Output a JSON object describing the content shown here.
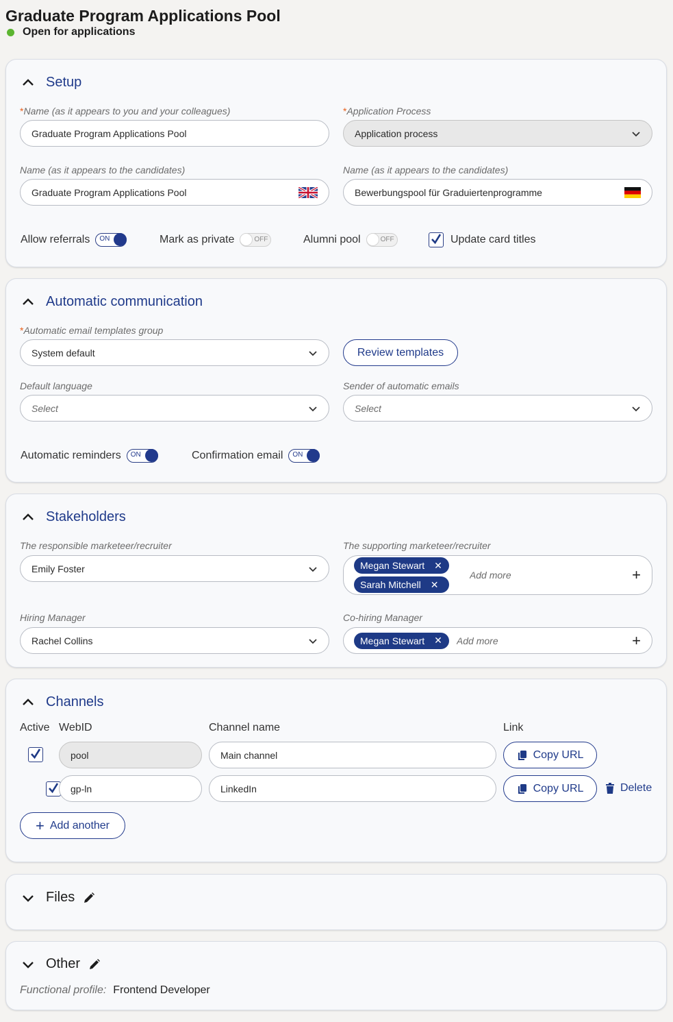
{
  "page": {
    "title": "Graduate Program Applications Pool",
    "status": "Open for applications"
  },
  "setup": {
    "title": "Setup",
    "name_internal_label": "Name (as it appears to you and your colleagues)",
    "name_internal_value": "Graduate Program Applications Pool",
    "process_label": "Application Process",
    "process_value": "Application process",
    "name_candidates_en_label": "Name (as it appears to the candidates)",
    "name_candidates_en_value": "Graduate Program Applications Pool",
    "name_candidates_de_label": "Name (as it appears to the candidates)",
    "name_candidates_de_value": "Bewerbungspool für Graduiertenprogramme",
    "allow_referrals": "Allow referrals",
    "mark_private": "Mark as private",
    "alumni_pool": "Alumni pool",
    "update_card_titles": "Update card titles",
    "on": "ON",
    "off": "OFF"
  },
  "communication": {
    "title": "Automatic communication",
    "templates_label": "Automatic email templates group",
    "templates_value": "System default",
    "review_button": "Review templates",
    "language_label": "Default language",
    "language_placeholder": "Select",
    "sender_label": "Sender of automatic emails",
    "sender_placeholder": "Select",
    "reminders": "Automatic reminders",
    "confirmation": "Confirmation email",
    "on": "ON"
  },
  "stakeholders": {
    "title": "Stakeholders",
    "responsible_label": "The responsible marketeer/recruiter",
    "responsible_value": "Emily Foster",
    "supporting_label": "The supporting marketeer/recruiter",
    "supporting_chips": [
      "Megan Stewart",
      "Sarah Mitchell"
    ],
    "add_more": "Add more",
    "hiring_label": "Hiring Manager",
    "hiring_value": "Rachel Collins",
    "cohiring_label": "Co-hiring Manager",
    "cohiring_chips": [
      "Megan Stewart"
    ]
  },
  "channels": {
    "title": "Channels",
    "col_active": "Active",
    "col_webid": "WebID",
    "col_name": "Channel name",
    "col_link": "Link",
    "rows": [
      {
        "webid": "pool",
        "name": "Main channel",
        "copy": "Copy URL"
      },
      {
        "webid": "gp-ln",
        "name": "LinkedIn",
        "copy": "Copy URL",
        "delete": "Delete"
      }
    ],
    "add_another": "Add another"
  },
  "files": {
    "title": "Files"
  },
  "other": {
    "title": "Other",
    "profile_label": "Functional profile:",
    "profile_value": "Frontend Developer"
  },
  "colors": {
    "accent": "#1e3a86",
    "status_green": "#5cb531",
    "required": "#e8601c"
  }
}
